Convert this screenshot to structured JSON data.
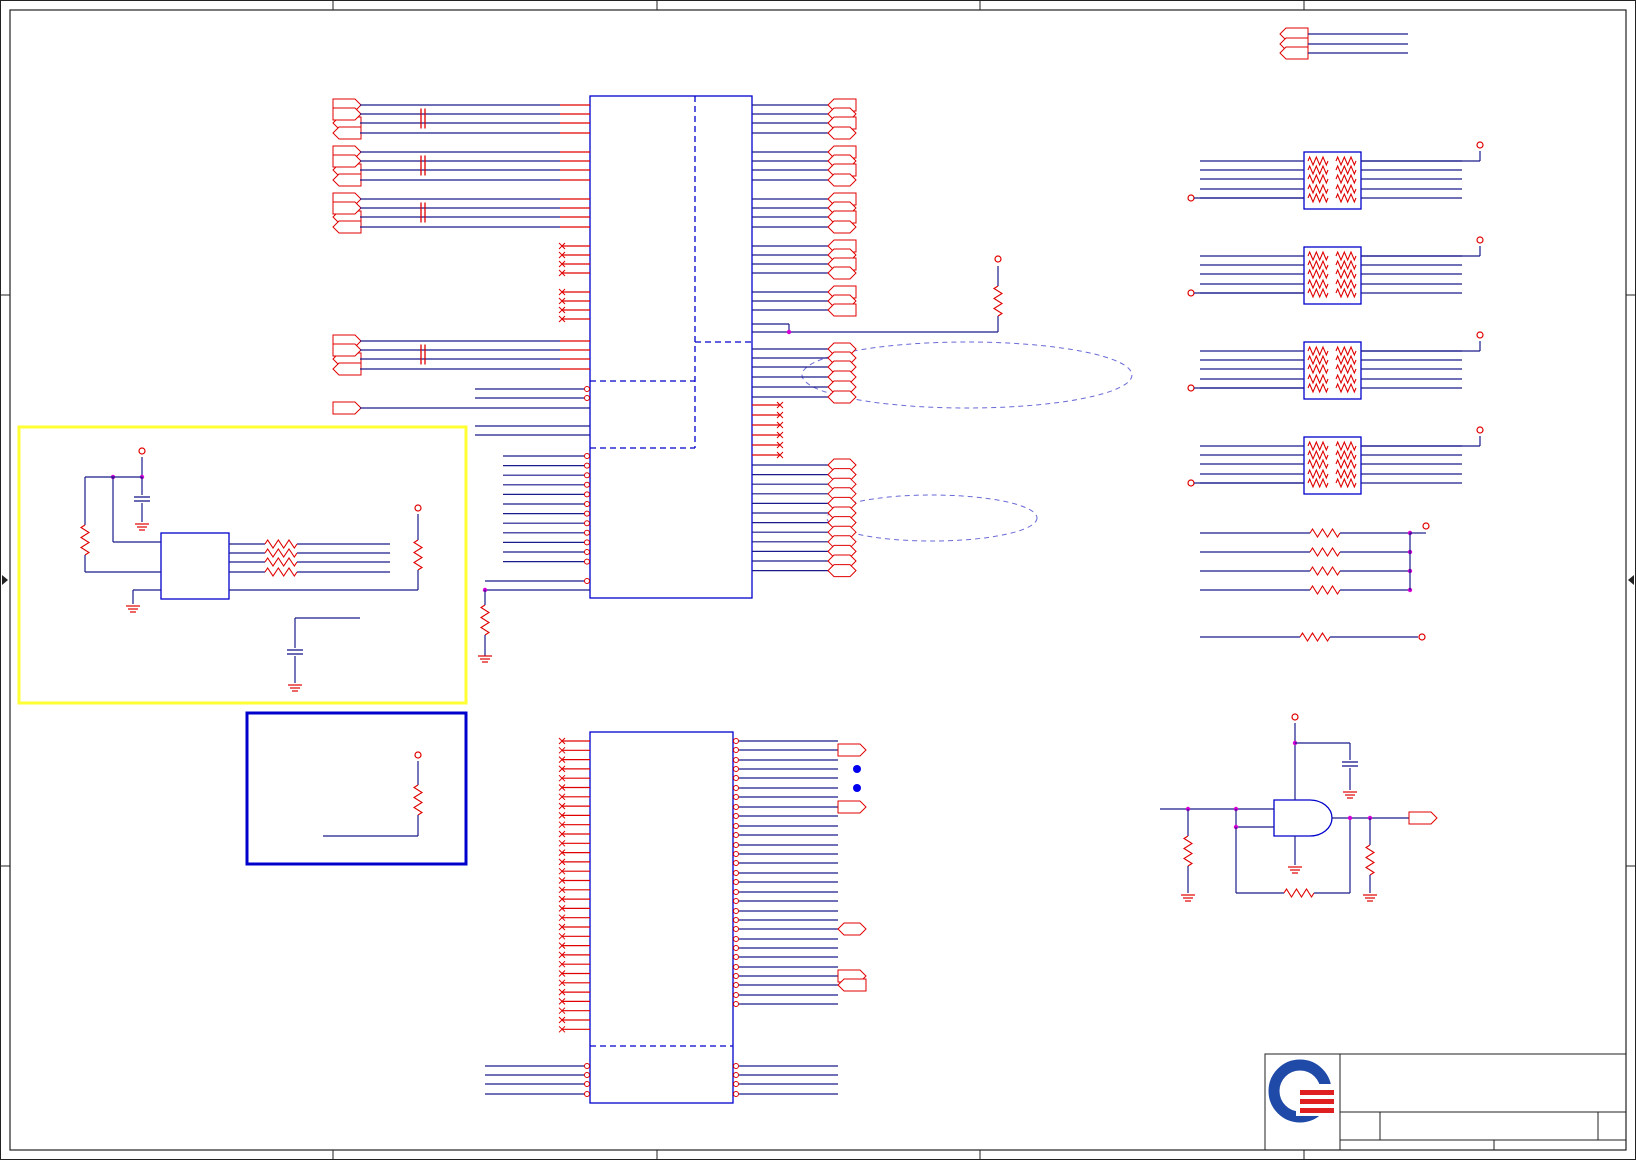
{
  "sheet": {
    "title": "",
    "border_color": "#222222"
  },
  "colors": {
    "wire": "#1a1a8c",
    "net": "#e00000",
    "component": "#e00000",
    "ic_outline": "#0000cc",
    "junction": "#d600d6",
    "highlight_box_yellow": "#ffff33",
    "highlight_box_blue": "#0000cc",
    "logo_blue": "#1f4aa8",
    "logo_red": "#e02020"
  },
  "title_block": {
    "logo": "company-logo"
  }
}
